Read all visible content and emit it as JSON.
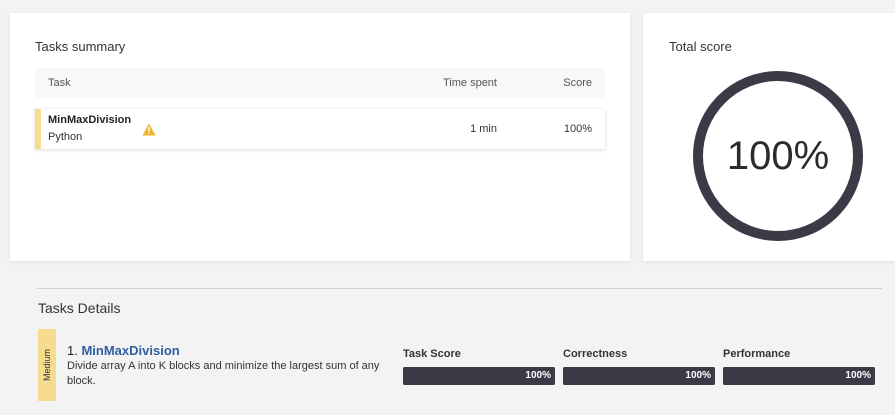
{
  "summary": {
    "title": "Tasks summary",
    "columns": {
      "task": "Task",
      "time": "Time spent",
      "score": "Score"
    },
    "rows": [
      {
        "name": "MinMaxDivision",
        "language": "Python",
        "time": "1 min",
        "score": "100%",
        "warning_icon": "warning-icon",
        "accent_color": "#f5dc8e"
      }
    ]
  },
  "total": {
    "title": "Total score",
    "value": "100%",
    "fraction": 1.0,
    "ring_color": "#3b3b48"
  },
  "details": {
    "title": "Tasks Details",
    "tasks": [
      {
        "difficulty": "Medium",
        "number": "1.",
        "name": "MinMaxDivision",
        "description": "Divide array A into K blocks and minimize the largest sum of any block.",
        "metrics": [
          {
            "label": "Task Score",
            "value": "100%",
            "fraction": 1.0
          },
          {
            "label": "Correctness",
            "value": "100%",
            "fraction": 1.0
          },
          {
            "label": "Performance",
            "value": "100%",
            "fraction": 1.0
          }
        ]
      }
    ]
  }
}
